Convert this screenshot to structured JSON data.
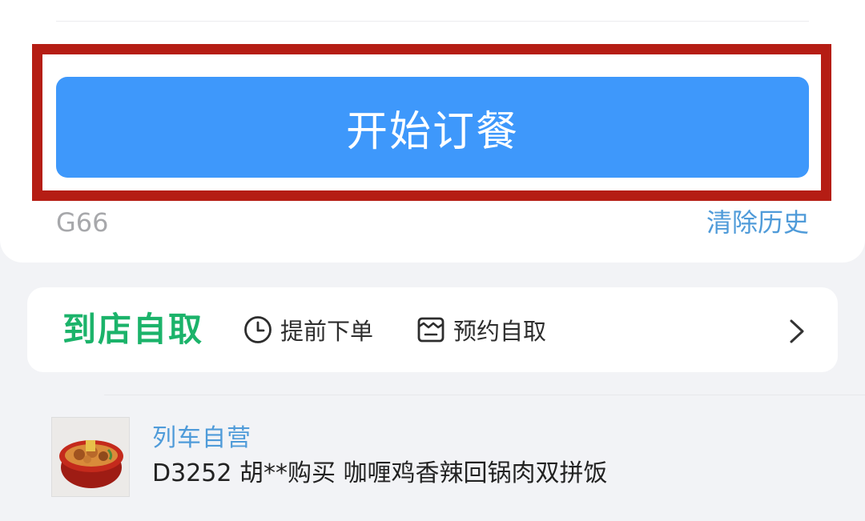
{
  "order_button": {
    "label": "开始订餐"
  },
  "history": {
    "train_number": "G66",
    "clear_label": "清除历史"
  },
  "pickup": {
    "title": "到店自取",
    "features": [
      {
        "icon": "clock-icon",
        "label": "提前下单"
      },
      {
        "icon": "pickup-box-icon",
        "label": "预约自取"
      }
    ],
    "chevron": "chevron-right-icon"
  },
  "recent_order": {
    "seller": "列车自营",
    "text": "D3252 胡**购买 咖喱鸡香辣回锅肉双拼饭",
    "thumbnail": "food-bowl-image"
  },
  "colors": {
    "primary_blue": "#3e98fb",
    "highlight_red": "#b51d14",
    "pickup_green": "#1bb36a",
    "link_blue": "#4f9bd9"
  }
}
